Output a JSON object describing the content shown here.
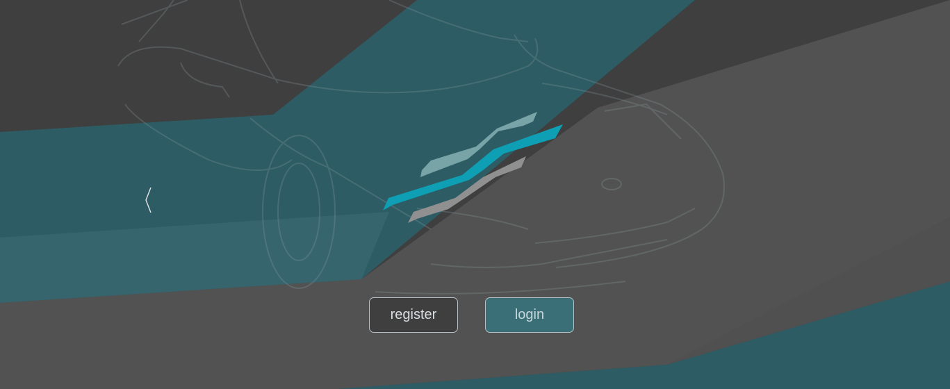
{
  "colors": {
    "background_dark": "#3f3f3f",
    "band_teal": "#2d5c64",
    "band_grey": "#525252",
    "logo_top": "#78a4a8",
    "logo_mid": "#0f9fb4",
    "logo_bottom": "#909090",
    "button_border": "#b8c2c6"
  },
  "icons": {
    "back": "chevron-left-icon",
    "logo": "speed-stripes-logo-icon",
    "background": "car-outline-illustration"
  },
  "actions": {
    "register_label": "register",
    "login_label": "login"
  }
}
